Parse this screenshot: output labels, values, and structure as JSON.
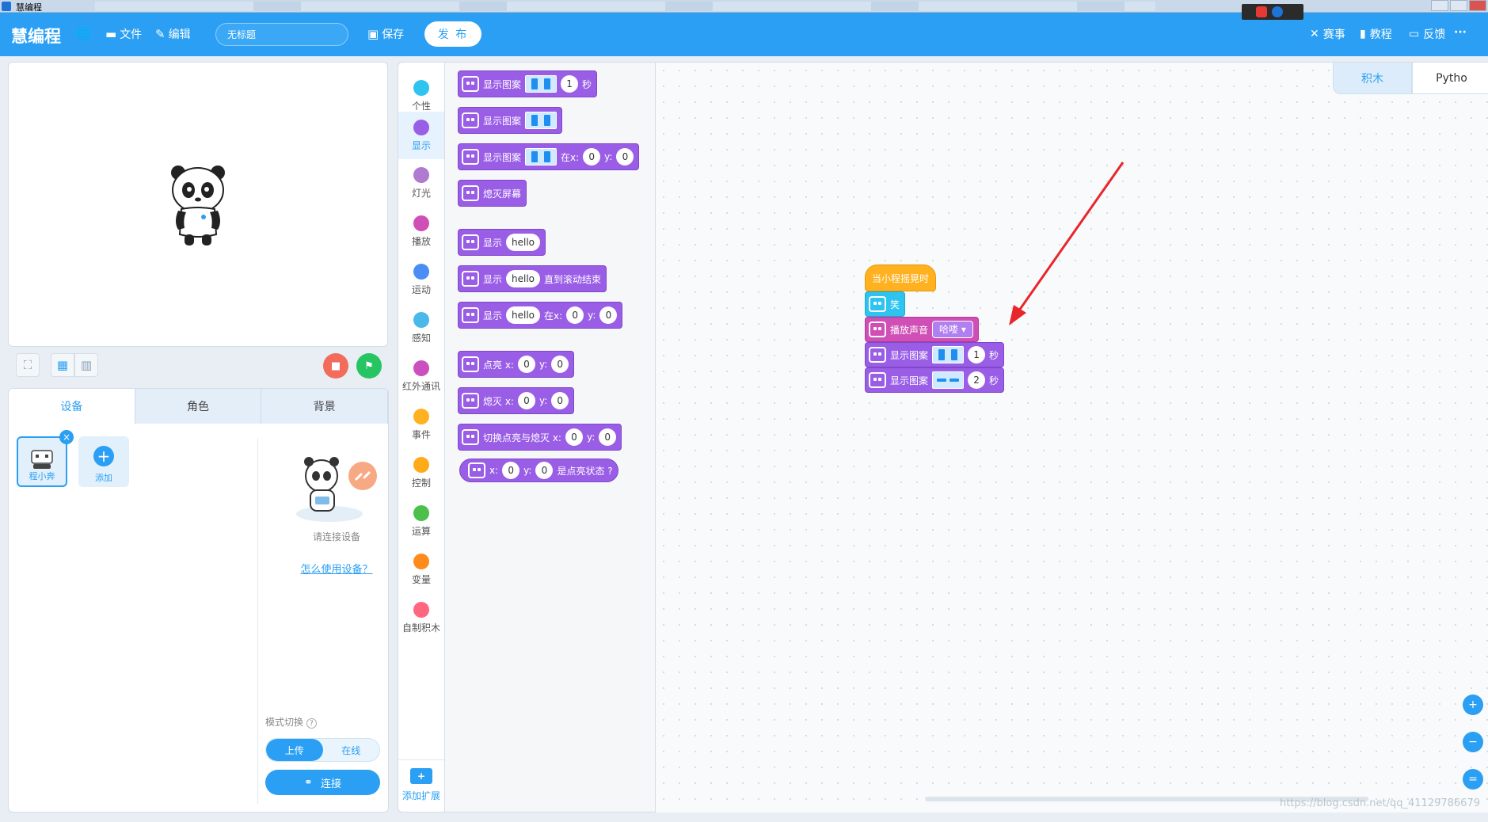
{
  "window": {
    "title": "慧编程"
  },
  "topbar": {
    "logo": "慧编程",
    "file": "文件",
    "edit": "编辑",
    "project_title": "无标题",
    "save": "保存",
    "publish": "发 布",
    "contest": "赛事",
    "tutorial": "教程",
    "feedback": "反馈",
    "more": "···"
  },
  "stage_panel": {
    "tabs": [
      "设备",
      "角色",
      "背景"
    ],
    "device_name": "程小奔",
    "add_label": "添加",
    "connect_hint": "请连接设备",
    "how_to_link": "怎么使用设备？",
    "mode_label": "模式切换",
    "mode_options": [
      "上传",
      "在线"
    ],
    "connect_label": "连接"
  },
  "categories": [
    {
      "label": "个性",
      "color": "#2fc4f0"
    },
    {
      "label": "显示",
      "color": "#9a5ee6"
    },
    {
      "label": "灯光",
      "color": "#b07ad0"
    },
    {
      "label": "播放",
      "color": "#d04fb6"
    },
    {
      "label": "运动",
      "color": "#4a8ef5"
    },
    {
      "label": "感知",
      "color": "#4bb8ea"
    },
    {
      "label": "红外通讯",
      "color": "#cc4fbf"
    },
    {
      "label": "事件",
      "color": "#ffb11f"
    },
    {
      "label": "控制",
      "color": "#ffab19"
    },
    {
      "label": "运算",
      "color": "#4cc04a"
    },
    {
      "label": "变量",
      "color": "#ff8c1a"
    },
    {
      "label": "自制积木",
      "color": "#ff6680"
    }
  ],
  "add_extension": "添加扩展",
  "palette": {
    "b1": {
      "label": "显示图案",
      "num": "1",
      "unit": "秒"
    },
    "b2": {
      "label": "显示图案"
    },
    "b3": {
      "label": "显示图案",
      "at": "在x:",
      "x": "0",
      "y_label": "y:",
      "y": "0"
    },
    "b4": {
      "label": "熄灭屏幕"
    },
    "b5": {
      "label": "显示",
      "text": "hello"
    },
    "b6": {
      "label": "显示",
      "text": "hello",
      "suffix": "直到滚动结束"
    },
    "b7": {
      "label": "显示",
      "text": "hello",
      "at": "在x:",
      "x": "0",
      "y_label": "y:",
      "y": "0"
    },
    "b8": {
      "label": "点亮 x:",
      "x": "0",
      "y_label": "y:",
      "y": "0"
    },
    "b9": {
      "label": "熄灭 x:",
      "x": "0",
      "y_label": "y:",
      "y": "0"
    },
    "b10": {
      "label": "切换点亮与熄灭 x:",
      "x": "0",
      "y_label": "y:",
      "y": "0"
    },
    "b11": {
      "x_label": "x:",
      "x": "0",
      "y_label": "y:",
      "y": "0",
      "suffix": "是点亮状态 ?"
    }
  },
  "workspace": {
    "tabs": [
      "积木",
      "Pytho"
    ],
    "script": {
      "hat": "当小程摇晃时",
      "s1": "笑",
      "s2_label": "播放声音",
      "s2_value": "哈喽 ▾",
      "s3_label": "显示图案",
      "s3_num": "1",
      "s3_unit": "秒",
      "s4_label": "显示图案",
      "s4_num": "2",
      "s4_unit": "秒"
    },
    "watermark": "https://blog.csdn.net/qq_41129786679"
  }
}
